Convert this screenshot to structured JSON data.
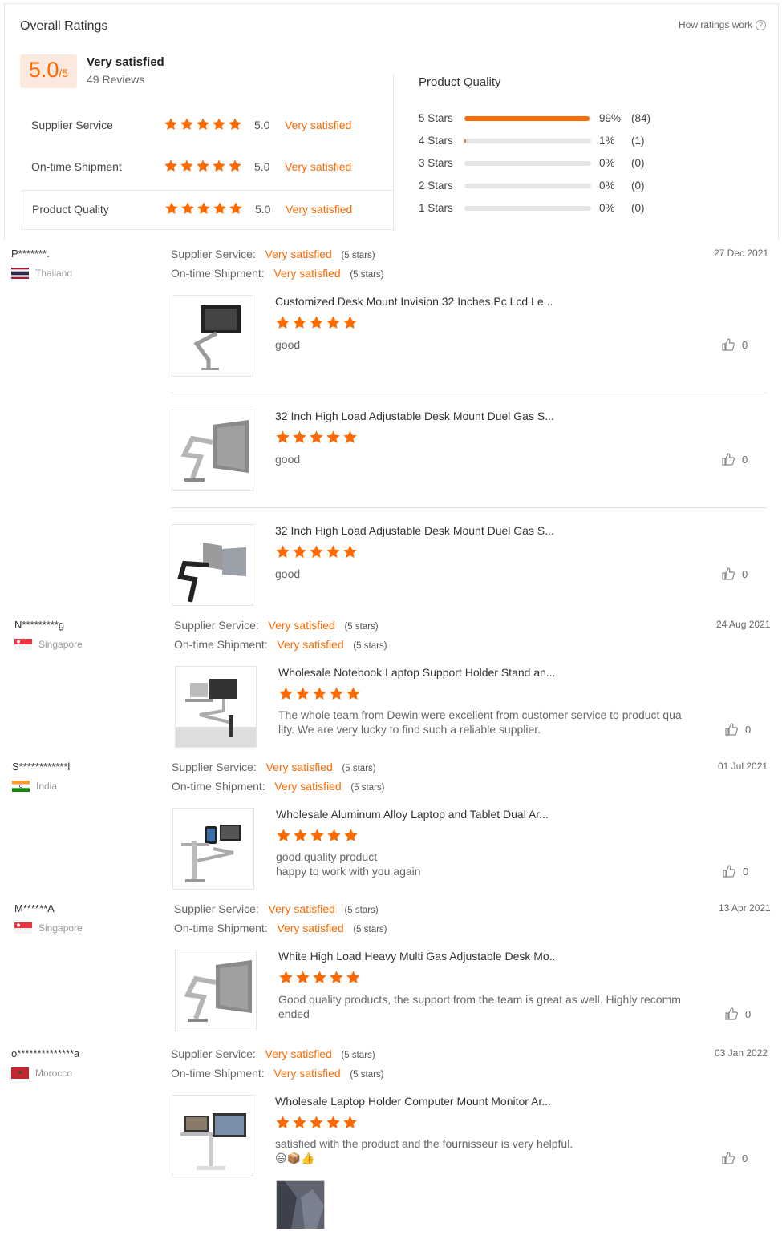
{
  "header": {
    "title": "Overall Ratings",
    "how_ratings_work": "How ratings work",
    "score": "5.0",
    "score_suffix": "/5",
    "summary": "Very satisfied",
    "reviews": "49 Reviews"
  },
  "ratings": [
    {
      "label": "Supplier Service",
      "value": "5.0",
      "text": "Very satisfied",
      "stars": 5
    },
    {
      "label": "On-time Shipment",
      "value": "5.0",
      "text": "Very satisfied",
      "stars": 5
    },
    {
      "label": "Product Quality",
      "value": "5.0",
      "text": "Very satisfied",
      "stars": 5
    }
  ],
  "product_quality": {
    "title": "Product Quality",
    "rows": [
      {
        "label": "5  Stars",
        "fraction": 0.99,
        "pct": "99%",
        "count": "(84)"
      },
      {
        "label": "4  Stars",
        "fraction": 0.01,
        "pct": "1%",
        "count": "(1)"
      },
      {
        "label": "3  Stars",
        "fraction": 0,
        "pct": "0%",
        "count": "(0)"
      },
      {
        "label": "2  Stars",
        "fraction": 0,
        "pct": "0%",
        "count": "(0)"
      },
      {
        "label": "1  Stars",
        "fraction": 0,
        "pct": "0%",
        "count": "(0)"
      }
    ]
  },
  "labels": {
    "supplier_service": "Supplier Service:",
    "ontime_shipment": "On-time Shipment:",
    "very_satisfied": "Very satisfied",
    "five_stars": "(5 stars)"
  },
  "reviews": [
    {
      "name": "P*******.",
      "country": "Thailand",
      "date": "27 Dec 2021",
      "products": [
        {
          "title": "Customized Desk Mount Invision 32 Inches Pc Lcd Le...",
          "comment": "good",
          "likes": "0"
        },
        {
          "title": "32 Inch High Load Adjustable Desk Mount Duel Gas S...",
          "comment": "good",
          "likes": "0"
        },
        {
          "title": "32 Inch High Load Adjustable Desk Mount Duel Gas S...",
          "comment": "good",
          "likes": "0"
        }
      ]
    },
    {
      "name": "N*********g",
      "country": "Singapore",
      "date": "24 Aug 2021",
      "products": [
        {
          "title": "Wholesale Notebook Laptop Support Holder Stand an...",
          "comment_l1": "The whole team from Dewin were excellent from customer service to product qua",
          "comment_l2": "lity. We are very lucky to find such a reliable supplier.",
          "likes": "0"
        }
      ]
    },
    {
      "name": "S************l",
      "country": "India",
      "date": "01 Jul 2021",
      "products": [
        {
          "title": "Wholesale Aluminum Alloy Laptop and Tablet Dual Ar...",
          "comment_l1": "good quality product",
          "comment_l2": "happy to work with you again",
          "likes": "0"
        }
      ]
    },
    {
      "name": "M******A",
      "country": "Singapore",
      "date": "13 Apr 2021",
      "products": [
        {
          "title": "White High Load Heavy Multi Gas Adjustable Desk Mo...",
          "comment_l1": "Good quality products, the support from the team is great as well. Highly recomm",
          "comment_l2": "ended",
          "likes": "0"
        }
      ]
    },
    {
      "name": "o**************a",
      "country": "Morocco",
      "date": "03 Jan 2022",
      "products": [
        {
          "title": "Wholesale Laptop Holder Computer Mount Monitor Ar...",
          "comment_l1": "satisfied with the product and the fournisseur is very helpful.",
          "comment_l2": "😃📦👍",
          "likes": "0"
        }
      ]
    }
  ],
  "colors": {
    "accent": "#ff6a00",
    "score_bg": "#fbe9df",
    "track": "#e6e6e6"
  },
  "icons": [
    "help-icon",
    "star-icon",
    "thumbs-up-icon",
    "flag-icon"
  ]
}
